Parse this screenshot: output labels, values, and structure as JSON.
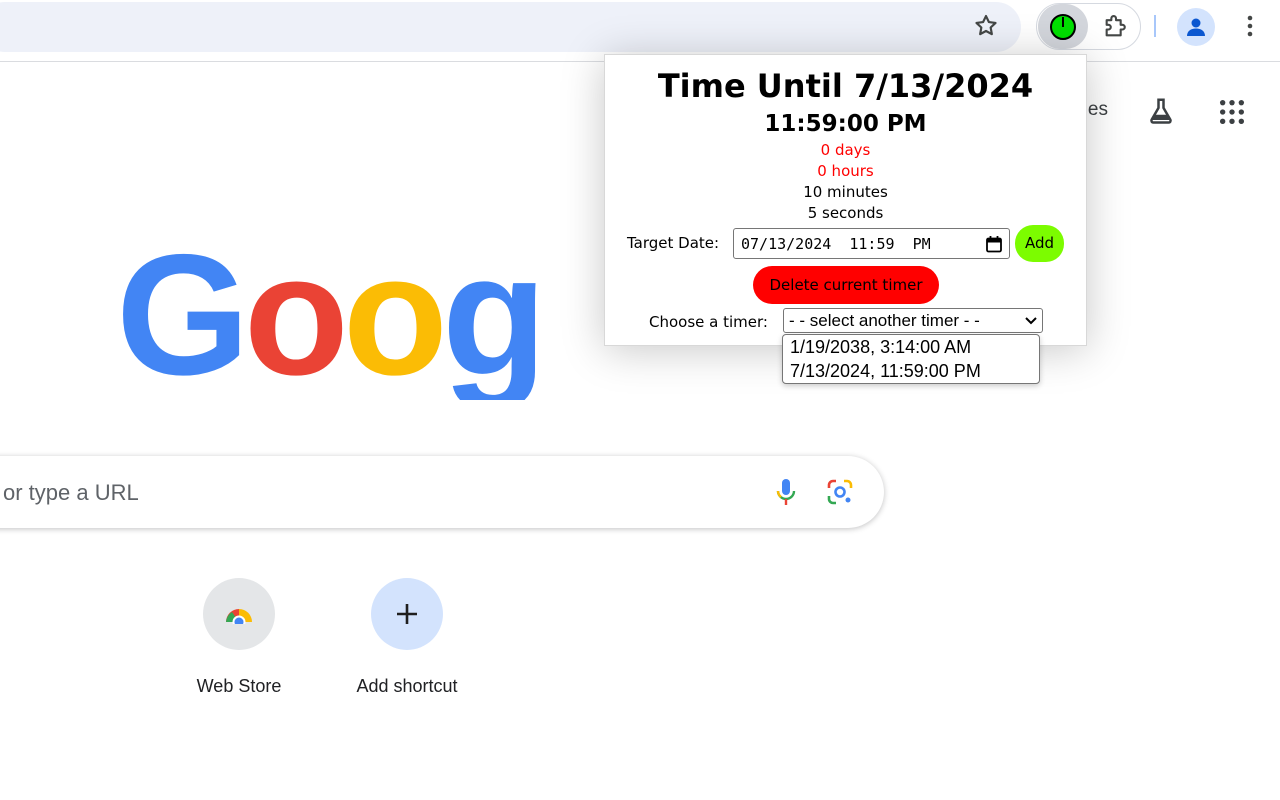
{
  "browser": {
    "toolbar": {
      "bookmark_icon": "star-icon",
      "timer_extension_icon": "green-clock-icon",
      "extensions_icon": "puzzle-icon",
      "profile_icon": "account-icon",
      "menu_icon": "kebab-menu-icon"
    }
  },
  "ntp": {
    "top_right_link": "es",
    "labs_icon": "flask-icon",
    "apps_icon": "apps-grid-icon",
    "logo_text": "Google",
    "logo_colors": [
      "#4285f4",
      "#ea4335",
      "#fbbc05",
      "#4285f4",
      "#34a853",
      "#ea4335"
    ],
    "search": {
      "placeholder": "or type a URL",
      "mic_icon": "microphone-icon",
      "lens_icon": "google-lens-icon"
    },
    "shortcuts": [
      {
        "label": "Web Store",
        "icon": "chrome-web-store-icon"
      },
      {
        "label": "Add shortcut",
        "icon": "plus-icon"
      }
    ]
  },
  "popup": {
    "title": "Time Until 7/13/2024",
    "subtitle": "11:59:00 PM",
    "countdown": {
      "days": "0 days",
      "hours": "0 hours",
      "minutes": "10 minutes",
      "seconds": "5 seconds"
    },
    "countdown_zero_color": "#ff0000",
    "target_label": "Target Date:",
    "target_value": "07/13/2024  11:59  PM",
    "add_label": "Add",
    "add_color": "#7cfc00",
    "delete_label": "Delete current timer",
    "delete_color": "#ff0000",
    "choose_label": "Choose a timer:",
    "select_value": "- - select another timer - -",
    "options": [
      "1/19/2038, 3:14:00 AM",
      "7/13/2024, 11:59:00 PM"
    ]
  }
}
